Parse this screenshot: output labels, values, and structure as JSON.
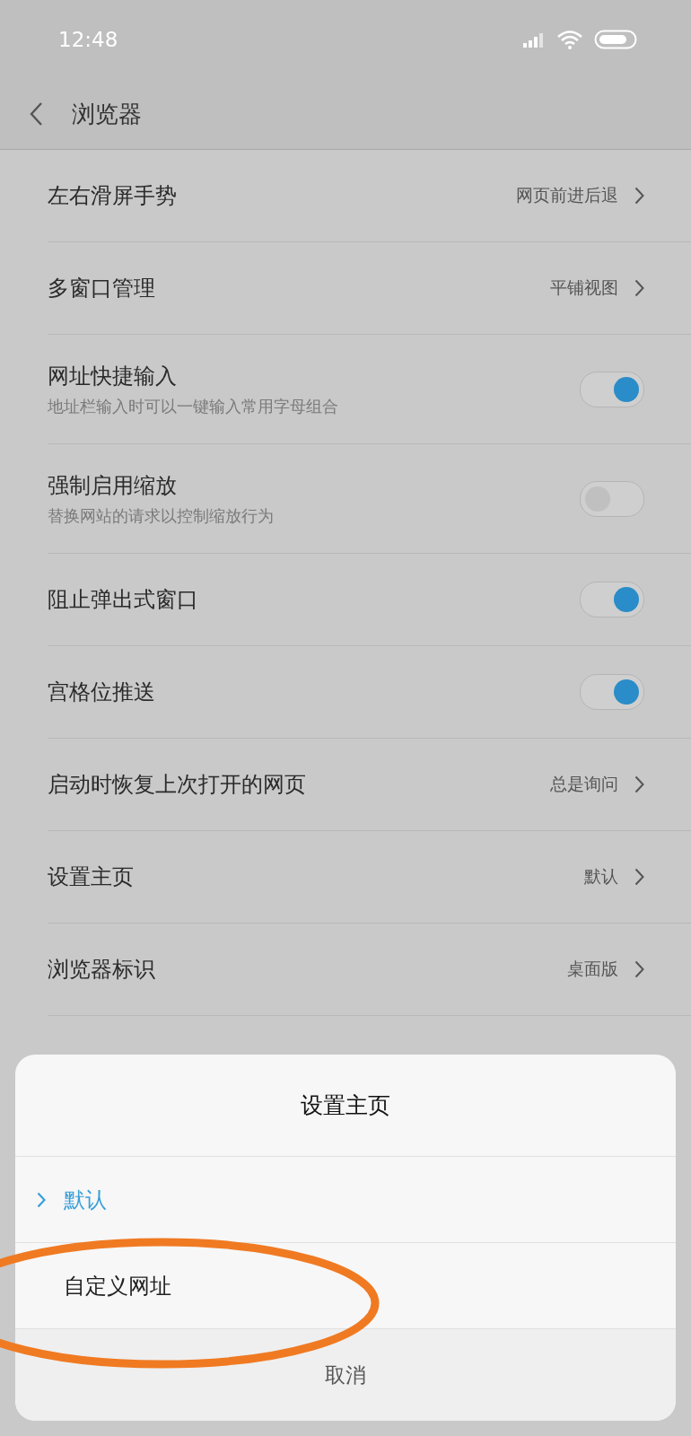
{
  "status_bar": {
    "time": "12:48"
  },
  "header": {
    "title": "浏览器"
  },
  "settings": [
    {
      "kind": "link",
      "label": "左右滑屏手势",
      "value": "网页前进后退"
    },
    {
      "kind": "link",
      "label": "多窗口管理",
      "value": "平铺视图"
    },
    {
      "kind": "toggle",
      "label": "网址快捷输入",
      "subtitle": "地址栏输入时可以一键输入常用字母组合",
      "on": true
    },
    {
      "kind": "toggle",
      "label": "强制启用缩放",
      "subtitle": "替换网站的请求以控制缩放行为",
      "on": false
    },
    {
      "kind": "toggle",
      "label": "阻止弹出式窗口",
      "on": true
    },
    {
      "kind": "toggle",
      "label": "宫格位推送",
      "on": true
    },
    {
      "kind": "link",
      "label": "启动时恢复上次打开的网页",
      "value": "总是询问"
    },
    {
      "kind": "link",
      "label": "设置主页",
      "value": "默认"
    },
    {
      "kind": "link",
      "label": "浏览器标识",
      "value": "桌面版"
    }
  ],
  "dialog": {
    "title": "设置主页",
    "options": [
      {
        "label": "默认",
        "selected": true
      },
      {
        "label": "自定义网址",
        "selected": false
      }
    ],
    "cancel": "取消"
  }
}
